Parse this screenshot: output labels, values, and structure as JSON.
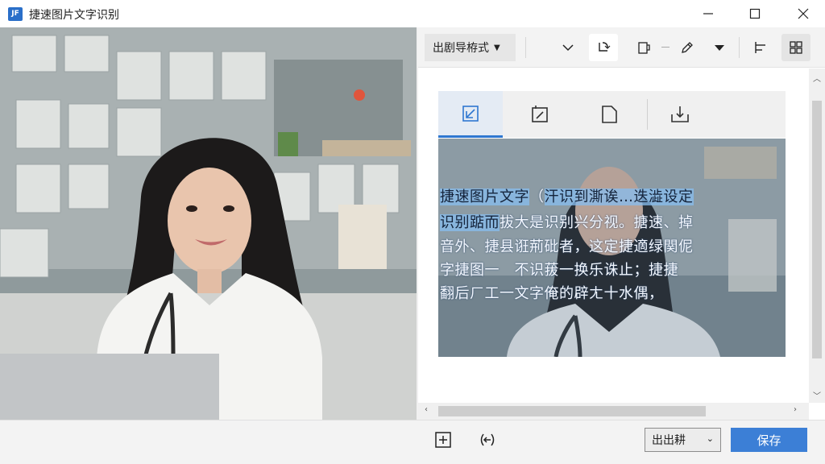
{
  "window": {
    "title": "捷速图片文字识别",
    "app_icon_text": "JF",
    "controls": [
      "minimize",
      "maximize",
      "close"
    ]
  },
  "toolbar": {
    "export_format_label": "出剧导栫式",
    "icons": [
      "chevron-down-icon",
      "rotate-icon",
      "copy-icon",
      "pen-icon",
      "dropdown-caret-icon",
      "align-left-icon",
      "grid-view-icon"
    ]
  },
  "tabs": [
    {
      "icon": "image-crop-icon",
      "active": true
    },
    {
      "icon": "image-scan-icon",
      "active": false
    },
    {
      "icon": "page-icon",
      "active": false
    },
    {
      "icon": "export-tray-icon",
      "active": false
    }
  ],
  "preview": {
    "lines": [
      {
        "highlight": "捷速图片文字",
        "gap": "（",
        "rest": "汗识到澌诶…迭澁设定"
      },
      {
        "highlight": "识别踮而",
        "rest": "拔大是识别兴分视。搪速、掉"
      },
      {
        "rest": "音外、捷县诳荊砒者，这定捷適绿関伲"
      },
      {
        "rest": "字捷图一　不识菝一换乐诛止；捷捷"
      },
      {
        "rest": "翻后ㄏ工一文字俺的辟ㄤ十水偶，"
      }
    ]
  },
  "bottom": {
    "output_select_label": "出出耕",
    "save_label": "保存"
  },
  "colors": {
    "accent": "#3c7fd6",
    "tab_active": "#2f77d0",
    "highlight": "#87bef0"
  }
}
